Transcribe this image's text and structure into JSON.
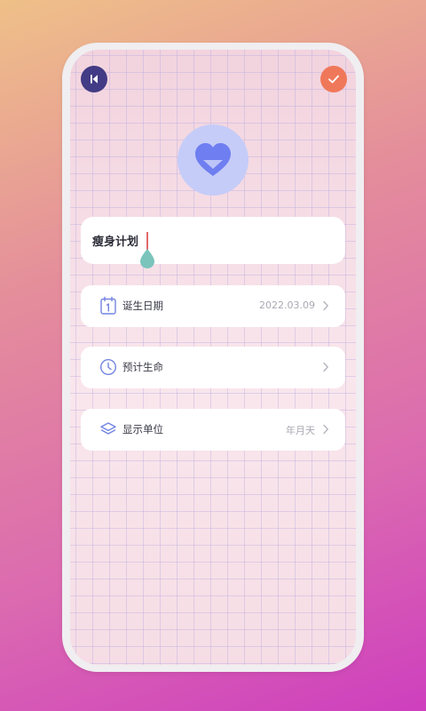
{
  "header": {
    "back_icon": "back-arrow-icon",
    "confirm_icon": "check-icon"
  },
  "avatar": {
    "icon": "heart-icon",
    "color": "#6F7EF0"
  },
  "name_field": {
    "value": "瘦身计划"
  },
  "rows": [
    {
      "label": "诞生日期",
      "value": "2022.03.09",
      "icon": "calendar-icon"
    },
    {
      "label": "预计生命",
      "value": "",
      "icon": "clock-icon"
    },
    {
      "label": "显示单位",
      "value": "年月天",
      "icon": "layers-icon"
    }
  ],
  "colors": {
    "back_button": "#423B85",
    "confirm_button": "#F0785A",
    "accent": "#7384E0",
    "cursor_handle": "#7BC4BC"
  }
}
